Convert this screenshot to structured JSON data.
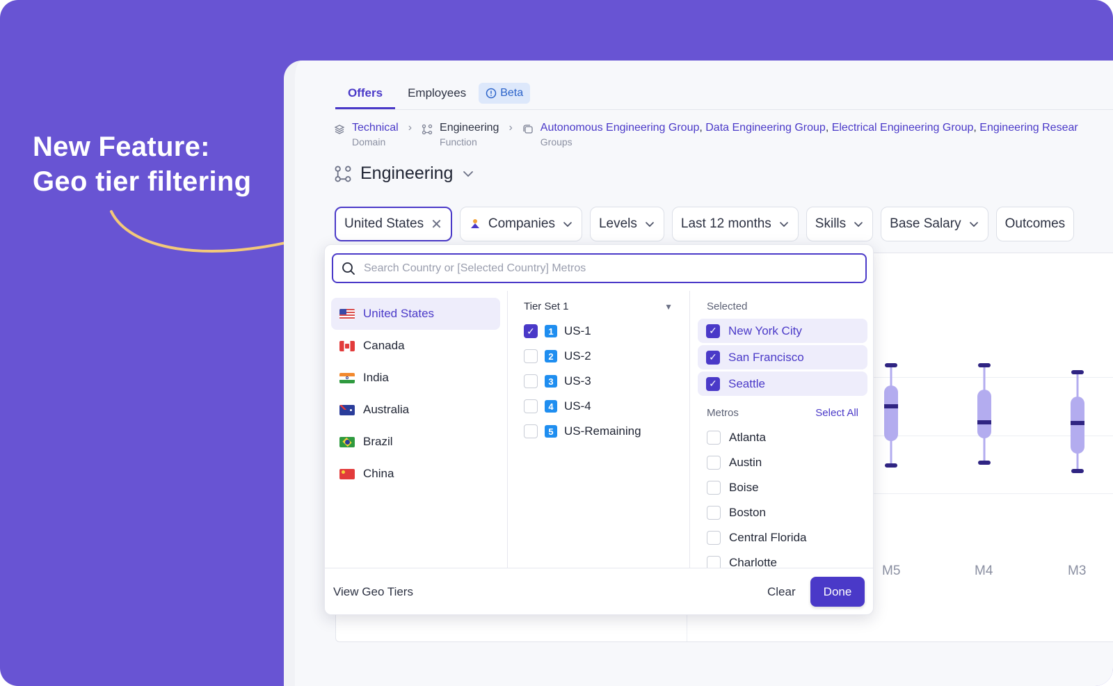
{
  "headline": {
    "line1": "New Feature:",
    "line2": "Geo tier filtering"
  },
  "colors": {
    "background": "#6854d3",
    "accent": "#4a39c8",
    "tier_badge": "#1f8ef0",
    "arrow": "#f3c97a"
  },
  "tabs": [
    {
      "label": "Offers",
      "active": true
    },
    {
      "label": "Employees",
      "active": false
    }
  ],
  "beta": {
    "label": "Beta",
    "icon": "alert-circle-icon"
  },
  "breadcrumb": {
    "domain": {
      "value": "Technical",
      "caption": "Domain"
    },
    "function": {
      "value": "Engineering",
      "caption": "Function"
    },
    "groups": {
      "items": [
        "Autonomous Engineering Group",
        "Data Engineering Group",
        "Electrical Engineering Group",
        "Engineering Resear"
      ],
      "caption": "Groups"
    }
  },
  "page_title": "Engineering",
  "filters": {
    "location": "United States",
    "companies": "Companies",
    "levels": "Levels",
    "period": "Last 12 months",
    "skills": "Skills",
    "base_salary": "Base Salary",
    "outcomes": "Outcomes"
  },
  "chart": {
    "x_labels": [
      "M5",
      "M4",
      "M3"
    ]
  },
  "dropdown": {
    "search_placeholder": "Search Country or [Selected Country] Metros",
    "countries": [
      {
        "name": "United States",
        "selected": true
      },
      {
        "name": "Canada",
        "selected": false
      },
      {
        "name": "India",
        "selected": false
      },
      {
        "name": "Australia",
        "selected": false
      },
      {
        "name": "Brazil",
        "selected": false
      },
      {
        "name": "China",
        "selected": false
      }
    ],
    "tier_set": "Tier Set 1",
    "tiers": [
      {
        "num": "1",
        "label": "US-1",
        "checked": true
      },
      {
        "num": "2",
        "label": "US-2",
        "checked": false
      },
      {
        "num": "3",
        "label": "US-3",
        "checked": false
      },
      {
        "num": "4",
        "label": "US-4",
        "checked": false
      },
      {
        "num": "5",
        "label": "US-Remaining",
        "checked": false
      }
    ],
    "selected_heading": "Selected",
    "selected": [
      "New York City",
      "San Francisco",
      "Seattle"
    ],
    "metros_heading": "Metros",
    "select_all": "Select All",
    "metros": [
      "Atlanta",
      "Austin",
      "Boise",
      "Boston",
      "Central Florida",
      "Charlotte"
    ],
    "view_geo_tiers": "View Geo Tiers",
    "clear": "Clear",
    "done": "Done"
  }
}
